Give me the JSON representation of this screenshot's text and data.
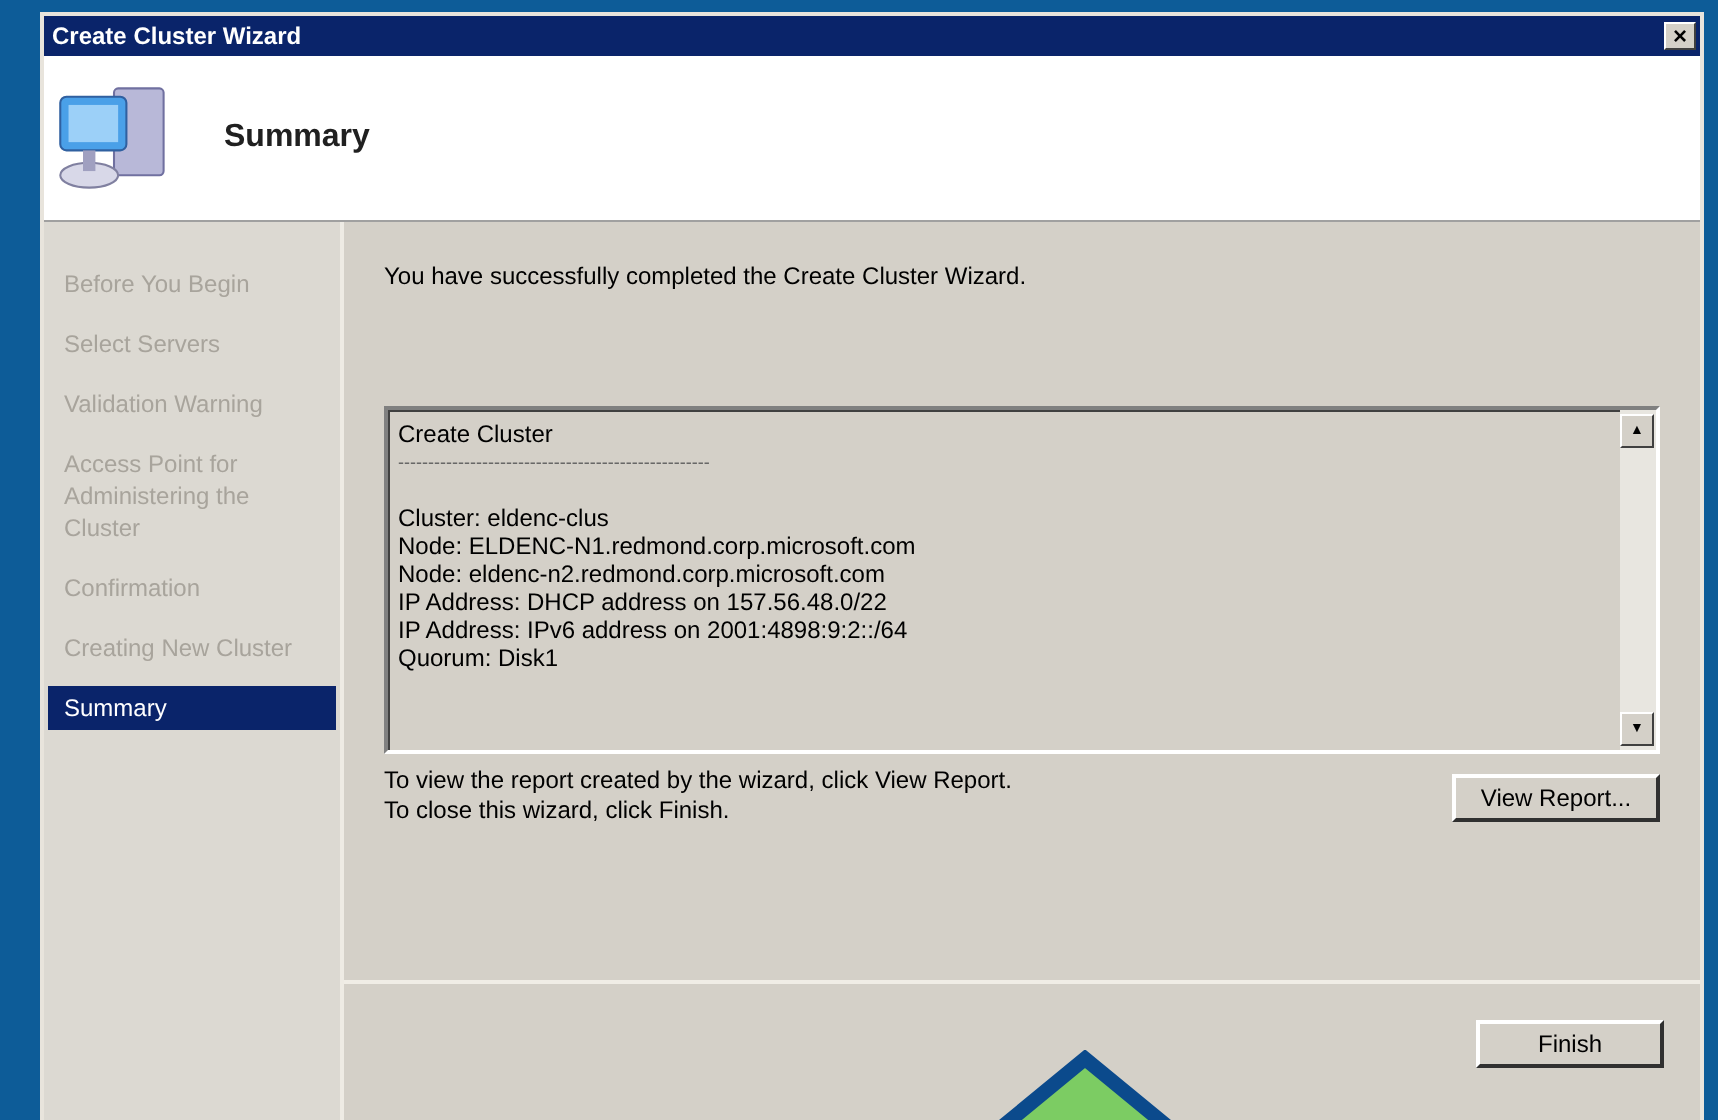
{
  "window": {
    "title": "Create Cluster Wizard",
    "close": "×"
  },
  "header": {
    "title": "Summary"
  },
  "steps": [
    {
      "label": "Before You Begin",
      "selected": false
    },
    {
      "label": "Select Servers",
      "selected": false
    },
    {
      "label": "Validation Warning",
      "selected": false
    },
    {
      "label": "Access Point for Administering the Cluster",
      "selected": false
    },
    {
      "label": "Confirmation",
      "selected": false
    },
    {
      "label": "Creating New Cluster",
      "selected": false
    },
    {
      "label": "Summary",
      "selected": true
    }
  ],
  "message": "You  have successfully completed the Create Cluster Wizard.",
  "report": {
    "title": "Create Cluster",
    "separator": "----------------------------------------------------",
    "lines": [
      "Cluster:  eldenc-clus",
      "Node:  ELDENC-N1.redmond.corp.microsoft.com",
      "Node:  eldenc-n2.redmond.corp.microsoft.com",
      "IP Address:  DHCP address on 157.56.48.0/22",
      "IP Address:  IPv6 address on 2001:4898:9:2::/64",
      "Quorum:  Disk1"
    ],
    "scroll_up": "▲",
    "scroll_down": "▼"
  },
  "hints": [
    "To view the report created by the wizard, click View Report.",
    "To close this wizard, click Finish."
  ],
  "buttons": {
    "view_report": "View Report...",
    "finish": "Finish"
  }
}
